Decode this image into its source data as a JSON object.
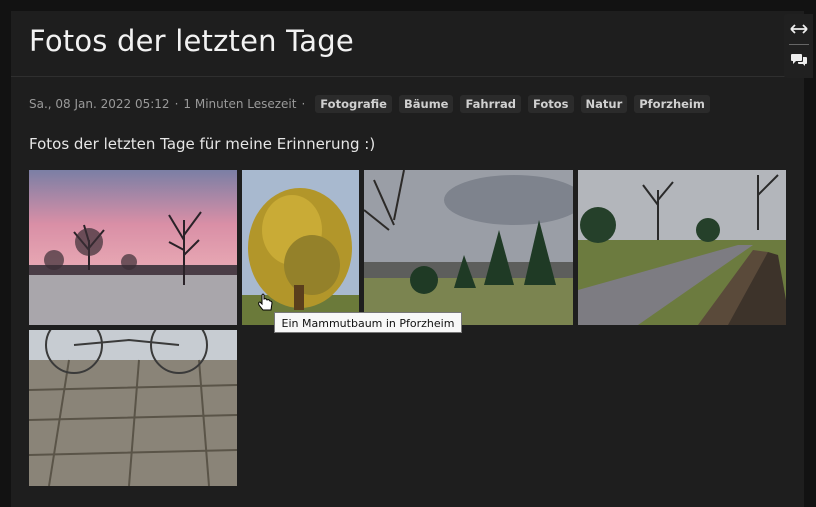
{
  "post": {
    "title": "Fotos der letzten Tage",
    "date": "Sa., 08 Jan. 2022 05:12",
    "meta_sep": "·",
    "reading_time": "1 Minuten Lesezeit",
    "tags": [
      "Fotografie",
      "Bäume",
      "Fahrrad",
      "Fotos",
      "Natur",
      "Pforzheim"
    ],
    "intro": "Fotos der letzten Tage für meine Erinnerung :)"
  },
  "gallery": {
    "photos": [
      {
        "subject": "pink sunrise sky over frosty meadow with bare trees"
      },
      {
        "subject": "golden sequoia tree"
      },
      {
        "subject": "green valley with town and cloudy sky"
      },
      {
        "subject": "asphalt path next to wooden bench"
      },
      {
        "subject": "paving stones with bicycles in background"
      }
    ]
  },
  "tooltip": {
    "text": "Ein Mammutbaum in Pforzheim"
  },
  "side_tools": [
    {
      "icon": "expand-width-icon"
    },
    {
      "icon": "comments-icon"
    }
  ]
}
